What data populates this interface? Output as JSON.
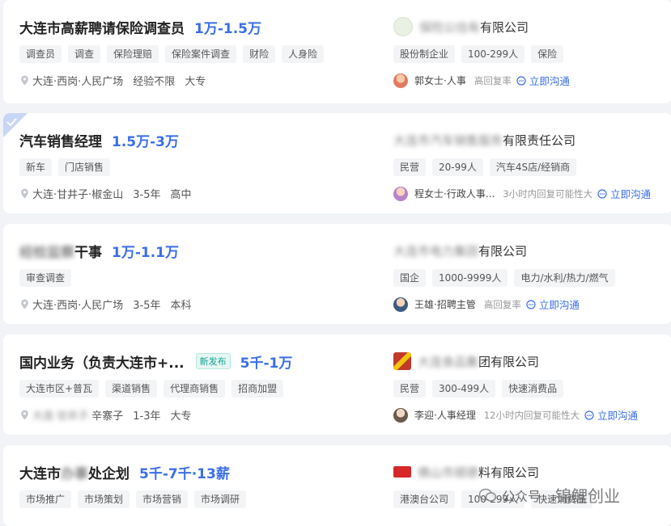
{
  "jobs": [
    {
      "title": "大连市高薪聘请保险调查员",
      "salary": "1万-1.5万",
      "new_badge": "",
      "tags": [
        "调查员",
        "调查",
        "保险理赔",
        "保险案件调查",
        "财险",
        "人身险"
      ],
      "location": "大连·西岗·人民广场",
      "experience": "经验不限",
      "education": "大专",
      "company_blur": "保险公估有",
      "company_visible": "有限公司",
      "company_tags": [
        "股份制企业",
        "100-299人",
        "保险"
      ],
      "recruiter_name": "郭女士",
      "recruiter_role": "人事",
      "reply": "高回复率",
      "chat": "立即沟通",
      "logo_color": "#d9ead3",
      "avatar_color": "#e07a5f"
    },
    {
      "title": "汽车销售经理",
      "salary": "1.5万-3万",
      "new_badge": "",
      "tags": [
        "新车",
        "门店销售"
      ],
      "location": "大连·甘井子·椒金山",
      "experience": "3-5年",
      "education": "高中",
      "company_blur": "大连市汽车销售服务",
      "company_visible": "有限责任公司",
      "company_tags": [
        "民营",
        "20-99人",
        "汽车4S店/经销商"
      ],
      "recruiter_name": "程女士",
      "recruiter_role": "行政人事...",
      "reply": "3小时内回复可能性大",
      "chat": "立即沟通",
      "logo_color": "",
      "avatar_color": "#c9a0dc"
    },
    {
      "title_blur": "经检监察",
      "title": "干事",
      "salary": "1万-1.1万",
      "new_badge": "",
      "tags": [
        "审查调查"
      ],
      "location": "大连·西岗·人民广场",
      "experience": "3-5年",
      "education": "本科",
      "company_blur": "大连市电力集团",
      "company_visible": "有限公司",
      "company_tags": [
        "国企",
        "1000-9999人",
        "电力/水利/热力/燃气"
      ],
      "recruiter_name": "王雄",
      "recruiter_role": "招聘主管",
      "reply": "高回复率",
      "chat": "立即沟通",
      "logo_color": "",
      "avatar_color": "#3d5a80"
    },
    {
      "title": "国内业务（负责大连市+...",
      "salary": "5千-1万",
      "new_badge": "新发布",
      "tags": [
        "大连市区+普瓦",
        "渠道销售",
        "代理商销售",
        "招商加盟"
      ],
      "location_blur": "大连·甘井子·",
      "location": "辛寨子",
      "experience": "1-3年",
      "education": "大专",
      "company_blur": "大连食品集",
      "company_visible": "团有限公司",
      "company_tags": [
        "民营",
        "300-499人",
        "快速消费品"
      ],
      "recruiter_name": "李迎",
      "recruiter_role": "人事经理",
      "reply": "12小时内回复可能性大",
      "chat": "立即沟通",
      "logo_color": "#c0392b",
      "avatar_color": "#7a6a5a"
    },
    {
      "title_blur_prefix": "大连市",
      "title_blur": "办事",
      "title": "处企划",
      "salary": "5千-7千·13薪",
      "new_badge": "",
      "tags": [
        "市场推广",
        "市场策划",
        "市场营销",
        "市场调研"
      ],
      "company_blur": "佛山市顺德",
      "company_visible": "料有限公司",
      "company_tags": [
        "港澳台公司",
        "100-299人",
        "快速消费品"
      ],
      "logo_color": "#d62828"
    }
  ],
  "watermark": {
    "prefix": "公众号",
    "brand": "锦鲤创业"
  },
  "colors": {
    "accent": "#3a6ee8",
    "new_badge": "#12a594"
  }
}
